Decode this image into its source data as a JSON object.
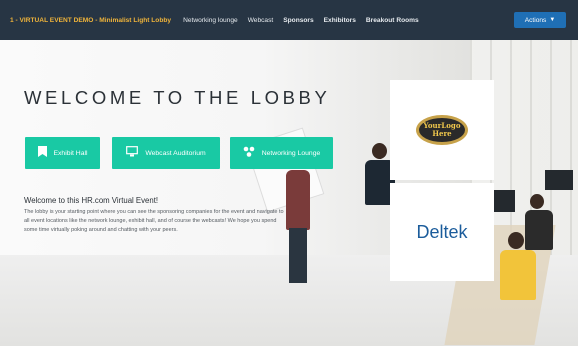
{
  "topbar": {
    "brand": "1 - VIRTUAL EVENT DEMO - Minimalist Light Lobby",
    "nav": [
      "Networking lounge",
      "Webcast",
      "Sponsors",
      "Exhibitors",
      "Breakout Rooms"
    ],
    "actions_label": "Actions",
    "bar_color": "#273544",
    "brand_color": "#f0b43a",
    "actions_color": "#1f6fb5"
  },
  "main": {
    "heading": "WELCOME TO THE LOBBY",
    "buttons": [
      {
        "label": "Exhibit Hall",
        "icon": "bookmark-icon"
      },
      {
        "label": "Webcast Auditorium",
        "icon": "monitor-icon"
      },
      {
        "label": "Networking Lounge",
        "icon": "network-icon"
      }
    ],
    "button_color": "#19c9a4",
    "intro_title": "Welcome to this HR.com Virtual Event!",
    "intro_body": "The lobby is your starting point where you can see the sponsoring companies for the event and navigate to all event locations like the network lounge, exhibit hall, and of course the webcasts! We hope you spend some time virtually poking around and chatting with your peers."
  },
  "sponsors": [
    {
      "logo_line1": "YourLogo",
      "logo_line2": "Here"
    },
    {
      "name": "Deltek",
      "color": "#1b5c9b"
    }
  ]
}
